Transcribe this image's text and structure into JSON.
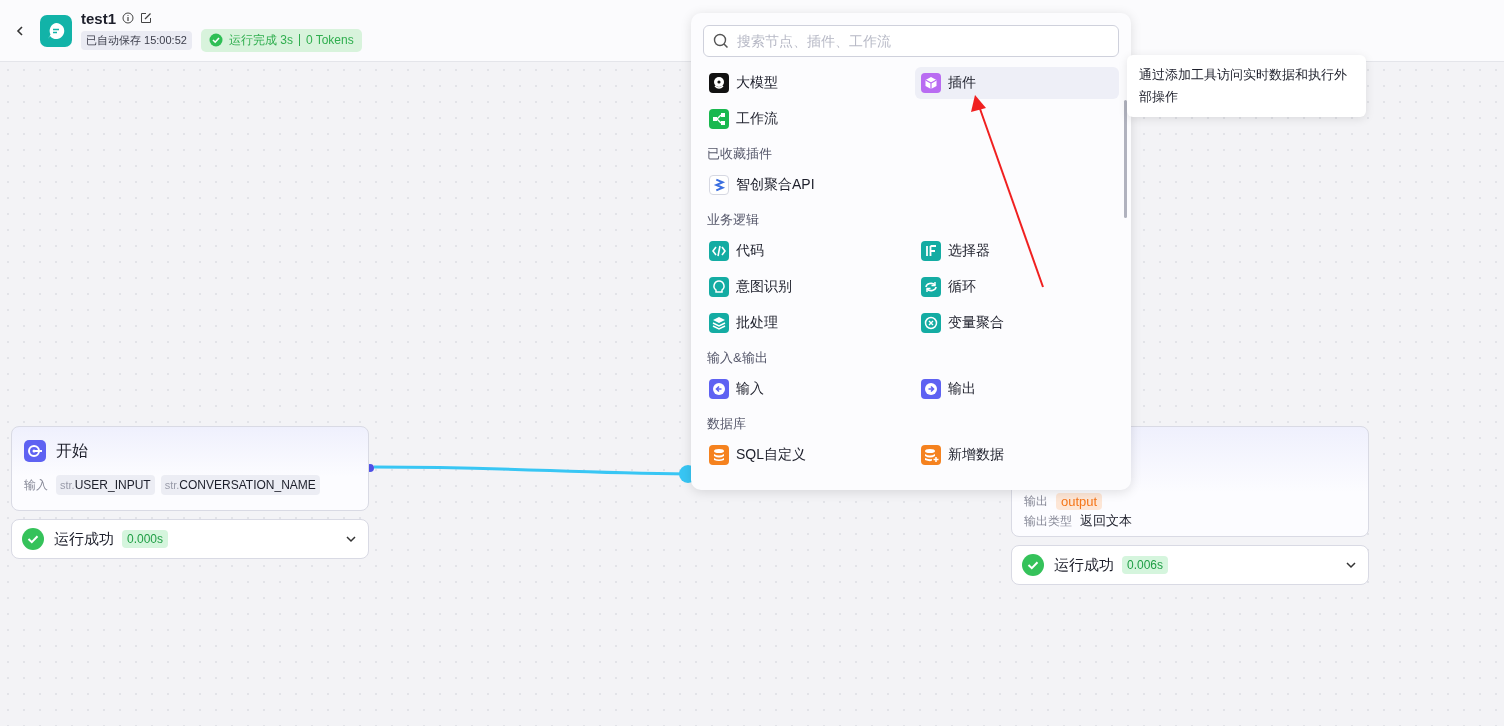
{
  "header": {
    "title": "test1",
    "autosave": "已自动保存 15:00:52",
    "run_status": "运行完成 3s",
    "tokens": "0 Tokens"
  },
  "nodes": [
    {
      "kind": "start",
      "title": "开始",
      "inputs_label": "输入",
      "params": [
        {
          "type": "str.",
          "name": "USER_INPUT"
        },
        {
          "type": "str.",
          "name": "CONVERSATION_NAME"
        }
      ],
      "run": {
        "status": "运行成功",
        "time": "0.000s",
        "expanded": false
      }
    },
    {
      "kind": "end",
      "output_label": "输出",
      "output_var": "output",
      "type_label": "输出类型",
      "type_value": "返回文本",
      "run": {
        "status": "运行成功",
        "time": "0.006s",
        "expanded": false
      }
    }
  ],
  "node_menu": {
    "search": {
      "placeholder": "搜索节点、插件、工作流"
    },
    "sections": [
      {
        "items": [
          {
            "label": "大模型",
            "kind": "llm",
            "color": "#111111",
            "selected": false
          },
          {
            "label": "插件",
            "kind": "plugin",
            "color": "#b96cf2",
            "selected": true
          },
          {
            "label": "工作流",
            "kind": "workflow",
            "color": "#19b84f",
            "selected": false
          }
        ]
      },
      {
        "heading": "已收藏插件",
        "items": [
          {
            "label": "智创聚合API",
            "kind": "api",
            "color": "#ffffff",
            "selected": false
          }
        ]
      },
      {
        "heading": "业务逻辑",
        "items": [
          {
            "label": "代码",
            "kind": "code",
            "color": "#14aca3",
            "selected": false
          },
          {
            "label": "选择器",
            "kind": "selector",
            "color": "#14aca3",
            "selected": false
          },
          {
            "label": "意图识别",
            "kind": "intent",
            "color": "#14aca3",
            "selected": false
          },
          {
            "label": "循环",
            "kind": "loop",
            "color": "#14aca3",
            "selected": false
          },
          {
            "label": "批处理",
            "kind": "batch",
            "color": "#14aca3",
            "selected": false
          },
          {
            "label": "变量聚合",
            "kind": "aggregate",
            "color": "#14aca3",
            "selected": false
          }
        ]
      },
      {
        "heading": "输入&输出",
        "items": [
          {
            "label": "输入",
            "kind": "input",
            "color": "#5e62f2",
            "selected": false
          },
          {
            "label": "输出",
            "kind": "output",
            "color": "#5e62f2",
            "selected": false
          }
        ]
      },
      {
        "heading": "数据库",
        "items": [
          {
            "label": "SQL自定义",
            "kind": "sql",
            "color": "#f5821f",
            "selected": false
          },
          {
            "label": "新增数据",
            "kind": "add_data",
            "color": "#f5821f",
            "selected": false
          }
        ]
      }
    ]
  },
  "tooltip": {
    "text": "通过添加工具访问实时数据和执行外部操作"
  }
}
